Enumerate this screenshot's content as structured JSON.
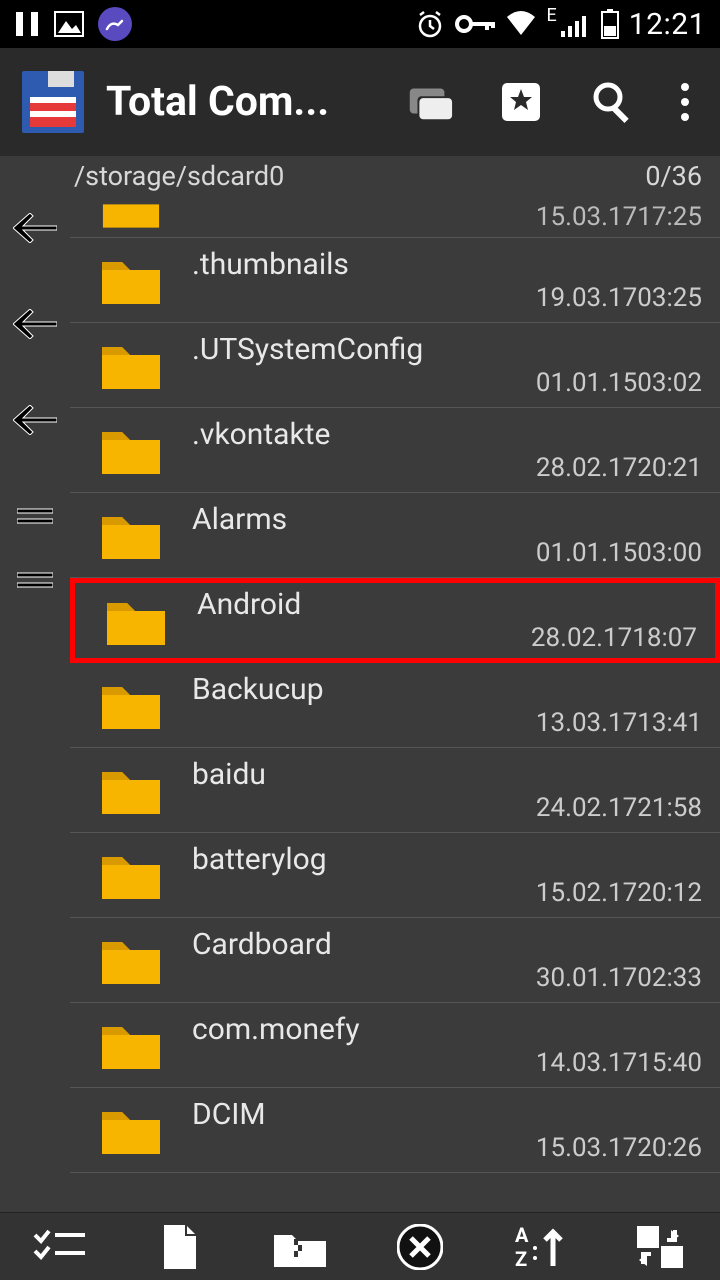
{
  "status": {
    "time": "12:21",
    "network_type": "E"
  },
  "appbar": {
    "title": "Total Com..."
  },
  "path": {
    "location": "/storage/sdcard0",
    "counter": "0/36"
  },
  "files": [
    {
      "name": "",
      "type": "<dir>",
      "date": "15.03.17",
      "time": "17:25",
      "partial": true
    },
    {
      "name": ".thumbnails",
      "type": "<dir>",
      "date": "19.03.17",
      "time": "03:25"
    },
    {
      "name": ".UTSystemConfig",
      "type": "<dir>",
      "date": "01.01.15",
      "time": "03:02"
    },
    {
      "name": ".vkontakte",
      "type": "<dir>",
      "date": "28.02.17",
      "time": "20:21"
    },
    {
      "name": "Alarms",
      "type": "<dir>",
      "date": "01.01.15",
      "time": "03:00"
    },
    {
      "name": "Android",
      "type": "<dir>",
      "date": "28.02.17",
      "time": "18:07",
      "highlight": true
    },
    {
      "name": "Backucup",
      "type": "<dir>",
      "date": "13.03.17",
      "time": "13:41"
    },
    {
      "name": "baidu",
      "type": "<dir>",
      "date": "24.02.17",
      "time": "21:58"
    },
    {
      "name": "batterylog",
      "type": "<dir>",
      "date": "15.02.17",
      "time": "20:12"
    },
    {
      "name": "Cardboard",
      "type": "<dir>",
      "date": "30.01.17",
      "time": "02:33"
    },
    {
      "name": "com.monefy",
      "type": "<dir>",
      "date": "14.03.17",
      "time": "15:40"
    },
    {
      "name": "DCIM",
      "type": "<dir>",
      "date": "15.03.17",
      "time": "20:26"
    }
  ]
}
